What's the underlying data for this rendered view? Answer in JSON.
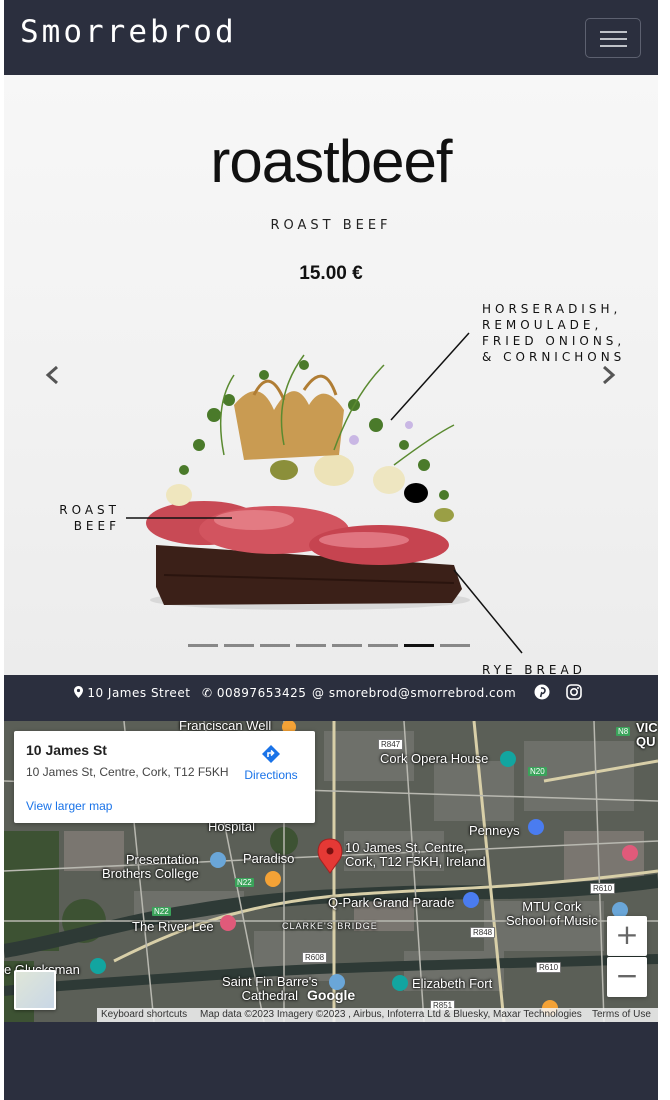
{
  "navbar": {
    "brand": "Smorrebrod",
    "toggle_icon": "hamburger-icon"
  },
  "carousel": {
    "title": "roastbeef",
    "subtitle": "ROAST BEEF",
    "price": "15.00 €",
    "annotations": {
      "top": [
        "HORSERADISH,",
        "REMOULADE,",
        "FRIED ONIONS,",
        "& CORNICHONS"
      ],
      "left": [
        "ROAST",
        "BEEF"
      ],
      "bottom": "RYE BREAD"
    },
    "prev_icon": "chevron-left-icon",
    "next_icon": "chevron-right-icon",
    "indicator_count": 8,
    "active_indicator": 7
  },
  "contact": {
    "address": "10 James Street",
    "phone": "00897653425",
    "email": "smorebrod@smorrebrod.com",
    "address_icon": "map-marker-icon",
    "phone_icon": "phone-icon",
    "email_icon": "at-icon",
    "social_icons": [
      "pinterest-icon",
      "instagram-icon"
    ]
  },
  "map": {
    "card": {
      "title": "10 James St",
      "address": "10 James St, Centre, Cork, T12 F5KH",
      "directions": "Directions",
      "larger_map": "View larger map"
    },
    "labels": {
      "franciscan": "Franciscan Well",
      "opera": "Cork Opera House",
      "hospital": "Hospital",
      "pin_address": "10 James St, Centre,\nCork, T12 F5KH, Ireland",
      "penneys": "Penneys",
      "presentation": "Presentation\nBrothers College",
      "paradiso": "Paradiso",
      "qpark": "Q-Park Grand Parade",
      "mtu": "MTU Cork\nSchool of Music",
      "riverlee": "The River Lee",
      "clarkes": "CLARKE'S BRIDGE",
      "gluckman": "e Glucksman",
      "finbarre": "Saint Fin Barre's\nCathedral",
      "elizabeth": "Elizabeth Fort",
      "vic": "VIC\nQU"
    },
    "road_tags": [
      "R847",
      "N20",
      "N22",
      "N22",
      "R610",
      "R848",
      "R608",
      "R610",
      "R851",
      "N8"
    ],
    "google": "Google",
    "footer": {
      "shortcuts": "Keyboard shortcuts",
      "attribution": "Map data ©2023 Imagery ©2023 , Airbus, Infoterra Ltd & Bluesky, Maxar Technologies",
      "terms": "Terms of Use"
    },
    "zoom_in": "+",
    "zoom_out": "−"
  }
}
